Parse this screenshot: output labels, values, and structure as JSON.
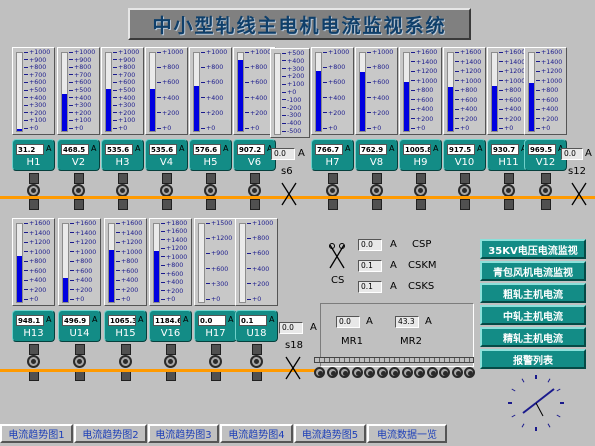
{
  "title": "中小型轧线主电机电流监视系统",
  "unit": "A",
  "row1": [
    {
      "name": "H1",
      "value": "31.2",
      "max": 1000,
      "ticks": [
        "+1000",
        "+900",
        "+800",
        "+700",
        "+600",
        "+500",
        "+400",
        "+300",
        "+200",
        "+100",
        "+0"
      ],
      "level": 0.03
    },
    {
      "name": "V2",
      "value": "468.5",
      "max": 1000,
      "ticks": [
        "+1000",
        "+900",
        "+800",
        "+700",
        "+600",
        "+500",
        "+400",
        "+300",
        "+200",
        "+100",
        "+0"
      ],
      "level": 0.47
    },
    {
      "name": "H3",
      "value": "535.6",
      "max": 1000,
      "ticks": [
        "+1000",
        "+900",
        "+800",
        "+700",
        "+600",
        "+500",
        "+400",
        "+300",
        "+200",
        "+100",
        "+0"
      ],
      "level": 0.54
    },
    {
      "name": "V4",
      "value": "535.6",
      "max": 1000,
      "ticks": [
        "+1000",
        "+800",
        "+600",
        "+400",
        "+200",
        "+0"
      ],
      "level": 0.54
    },
    {
      "name": "H5",
      "value": "576.6",
      "max": 1000,
      "ticks": [
        "+1000",
        "+800",
        "+600",
        "+400",
        "+200",
        "+0"
      ],
      "level": 0.58
    },
    {
      "name": "V6",
      "value": "907.2",
      "max": 1000,
      "ticks": [
        "+1000",
        "+800",
        "+600",
        "+400",
        "+200",
        "+0"
      ],
      "level": 0.91
    },
    {
      "name": "H7",
      "value": "766.7",
      "max": 1000,
      "ticks": [
        "+1000",
        "+800",
        "+600",
        "+400",
        "+200",
        "+0"
      ],
      "level": 0.77
    },
    {
      "name": "V8",
      "value": "762.9",
      "max": 1000,
      "ticks": [
        "+1000",
        "+800",
        "+600",
        "+400",
        "+200",
        "+0"
      ],
      "level": 0.76
    },
    {
      "name": "H9",
      "value": "1005.8",
      "max": 1600,
      "ticks": [
        "+1600",
        "+1400",
        "+1200",
        "+1000",
        "+800",
        "+600",
        "+400",
        "+200",
        "+0"
      ],
      "level": 0.63
    },
    {
      "name": "V10",
      "value": "917.5",
      "max": 1600,
      "ticks": [
        "+1600",
        "+1400",
        "+1200",
        "+1000",
        "+800",
        "+600",
        "+400",
        "+200",
        "+0"
      ],
      "level": 0.57
    },
    {
      "name": "H11",
      "value": "930.7",
      "max": 1600,
      "ticks": [
        "+1600",
        "+1400",
        "+1200",
        "+1000",
        "+800",
        "+600",
        "+400",
        "+200",
        "+0"
      ],
      "level": 0.58
    },
    {
      "name": "V12",
      "value": "969.5",
      "max": 1600,
      "ticks": [
        "+1600",
        "+1400",
        "+1200",
        "+1000",
        "+800",
        "+600",
        "+400",
        "+200",
        "+0"
      ],
      "level": 0.61
    }
  ],
  "row2": [
    {
      "name": "H13",
      "value": "948.1",
      "max": 1600,
      "ticks": [
        "+1600",
        "+1400",
        "+1200",
        "+1000",
        "+800",
        "+600",
        "+400",
        "+200",
        "+0"
      ],
      "level": 0.59
    },
    {
      "name": "U14",
      "value": "496.9",
      "max": 1600,
      "ticks": [
        "+1600",
        "+1400",
        "+1200",
        "+1000",
        "+800",
        "+600",
        "+400",
        "+200",
        "+0"
      ],
      "level": 0.31
    },
    {
      "name": "H15",
      "value": "1065.3",
      "max": 1600,
      "ticks": [
        "+1600",
        "+1400",
        "+1200",
        "+1000",
        "+800",
        "+600",
        "+400",
        "+200",
        "+0"
      ],
      "level": 0.67
    },
    {
      "name": "V16",
      "value": "1184.6",
      "max": 1800,
      "ticks": [
        "+1800",
        "+1600",
        "+1400",
        "+1200",
        "+1000",
        "+800",
        "+600",
        "+400",
        "+200",
        "+0"
      ],
      "level": 0.66
    },
    {
      "name": "H17",
      "value": "0.0",
      "max": 1500,
      "ticks": [
        "+1500",
        "+1200",
        "+900",
        "+600",
        "+300",
        "+0"
      ],
      "level": 0.0
    },
    {
      "name": "U18",
      "value": "0.1",
      "max": 1000,
      "ticks": [
        "+1000",
        "+800",
        "+600",
        "+400",
        "+200",
        "+0"
      ],
      "level": 0.0
    }
  ],
  "cs_gauge": {
    "ticks": [
      "+500",
      "+400",
      "+300",
      "+200",
      "+100",
      "+0",
      "-100",
      "-200",
      "-300",
      "-400",
      "-500"
    ],
    "level": 0.0
  },
  "shears": {
    "s6": {
      "label": "s6",
      "value": "0.0"
    },
    "s12": {
      "label": "s12",
      "value": "0.0"
    },
    "s18": {
      "label": "s18",
      "value": "0.0"
    },
    "cs": {
      "label": "CS"
    }
  },
  "cs_values": [
    {
      "value": "0.0",
      "label": "CSP"
    },
    {
      "value": "0.1",
      "label": "CSKM"
    },
    {
      "value": "0.1",
      "label": "CSKS"
    }
  ],
  "mr": [
    {
      "value": "0.0",
      "label": "MR1"
    },
    {
      "value": "43.3",
      "label": "MR2"
    }
  ],
  "nav_buttons": [
    "35KV电压电流监视",
    "青包风机电流监视",
    "粗轧主机电流",
    "中轧主机电流",
    "精轧主机电流",
    "报警列表"
  ],
  "tabs": [
    "电流趋势图1",
    "电流趋势图2",
    "电流趋势图3",
    "电流趋势图4",
    "电流趋势图5",
    "电流数据一览"
  ],
  "colors": {
    "background": "#c0c0c0",
    "panel": "#138c86",
    "bar": "#0000e0",
    "line": "#ff9a00",
    "tab_text": "#1d3fb8"
  }
}
